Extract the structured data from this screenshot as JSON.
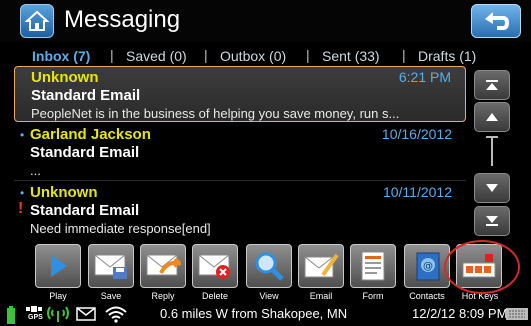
{
  "header": {
    "title": "Messaging",
    "home_icon": "home-icon",
    "back_icon": "back-arrow-icon"
  },
  "tabs": [
    {
      "label": "Inbox (7)",
      "active": true
    },
    {
      "label": "Saved (0)",
      "active": false
    },
    {
      "label": "Outbox (0)",
      "active": false
    },
    {
      "label": "Sent (33)",
      "active": false
    },
    {
      "label": "Drafts (1)",
      "active": false
    }
  ],
  "messages": [
    {
      "sender": "Unknown",
      "subject": "Standard Email",
      "preview": "PeopleNet is in the business of helping you save money, run s...",
      "time": "6:21 PM",
      "selected": true,
      "unread": false,
      "priority": false
    },
    {
      "sender": "Garland Jackson",
      "subject": "Standard Email",
      "preview": "...",
      "time": "10/16/2012",
      "selected": false,
      "unread": true,
      "priority": false
    },
    {
      "sender": "Unknown",
      "subject": "Standard Email",
      "preview": "Need immediate response[end]",
      "time": "10/11/2012",
      "selected": false,
      "unread": true,
      "priority": true
    }
  ],
  "toolbar": [
    {
      "label": "Play",
      "icon": "play-icon"
    },
    {
      "label": "Save",
      "icon": "save-envelope-icon"
    },
    {
      "label": "Reply",
      "icon": "reply-envelope-icon"
    },
    {
      "label": "Delete",
      "icon": "delete-envelope-icon"
    },
    {
      "label": "View",
      "icon": "magnifier-icon"
    },
    {
      "label": "Email",
      "icon": "email-pen-icon"
    },
    {
      "label": "Form",
      "icon": "form-document-icon"
    },
    {
      "label": "Contacts",
      "icon": "contacts-book-icon"
    },
    {
      "label": "Hot Keys",
      "icon": "hot-keys-icon"
    }
  ],
  "status": {
    "gps_label": "GPS",
    "location": "0.6 miles W from Shakopee, MN",
    "datetime": "12/2/12 8:09 PM"
  },
  "colors": {
    "tab_active": "#5aaee8",
    "sender": "#e6e600",
    "date": "#5aaee8",
    "selected_border": "#f2a75a",
    "priority": "#e53b2e",
    "hotkey_ring": "#d42a2a"
  }
}
